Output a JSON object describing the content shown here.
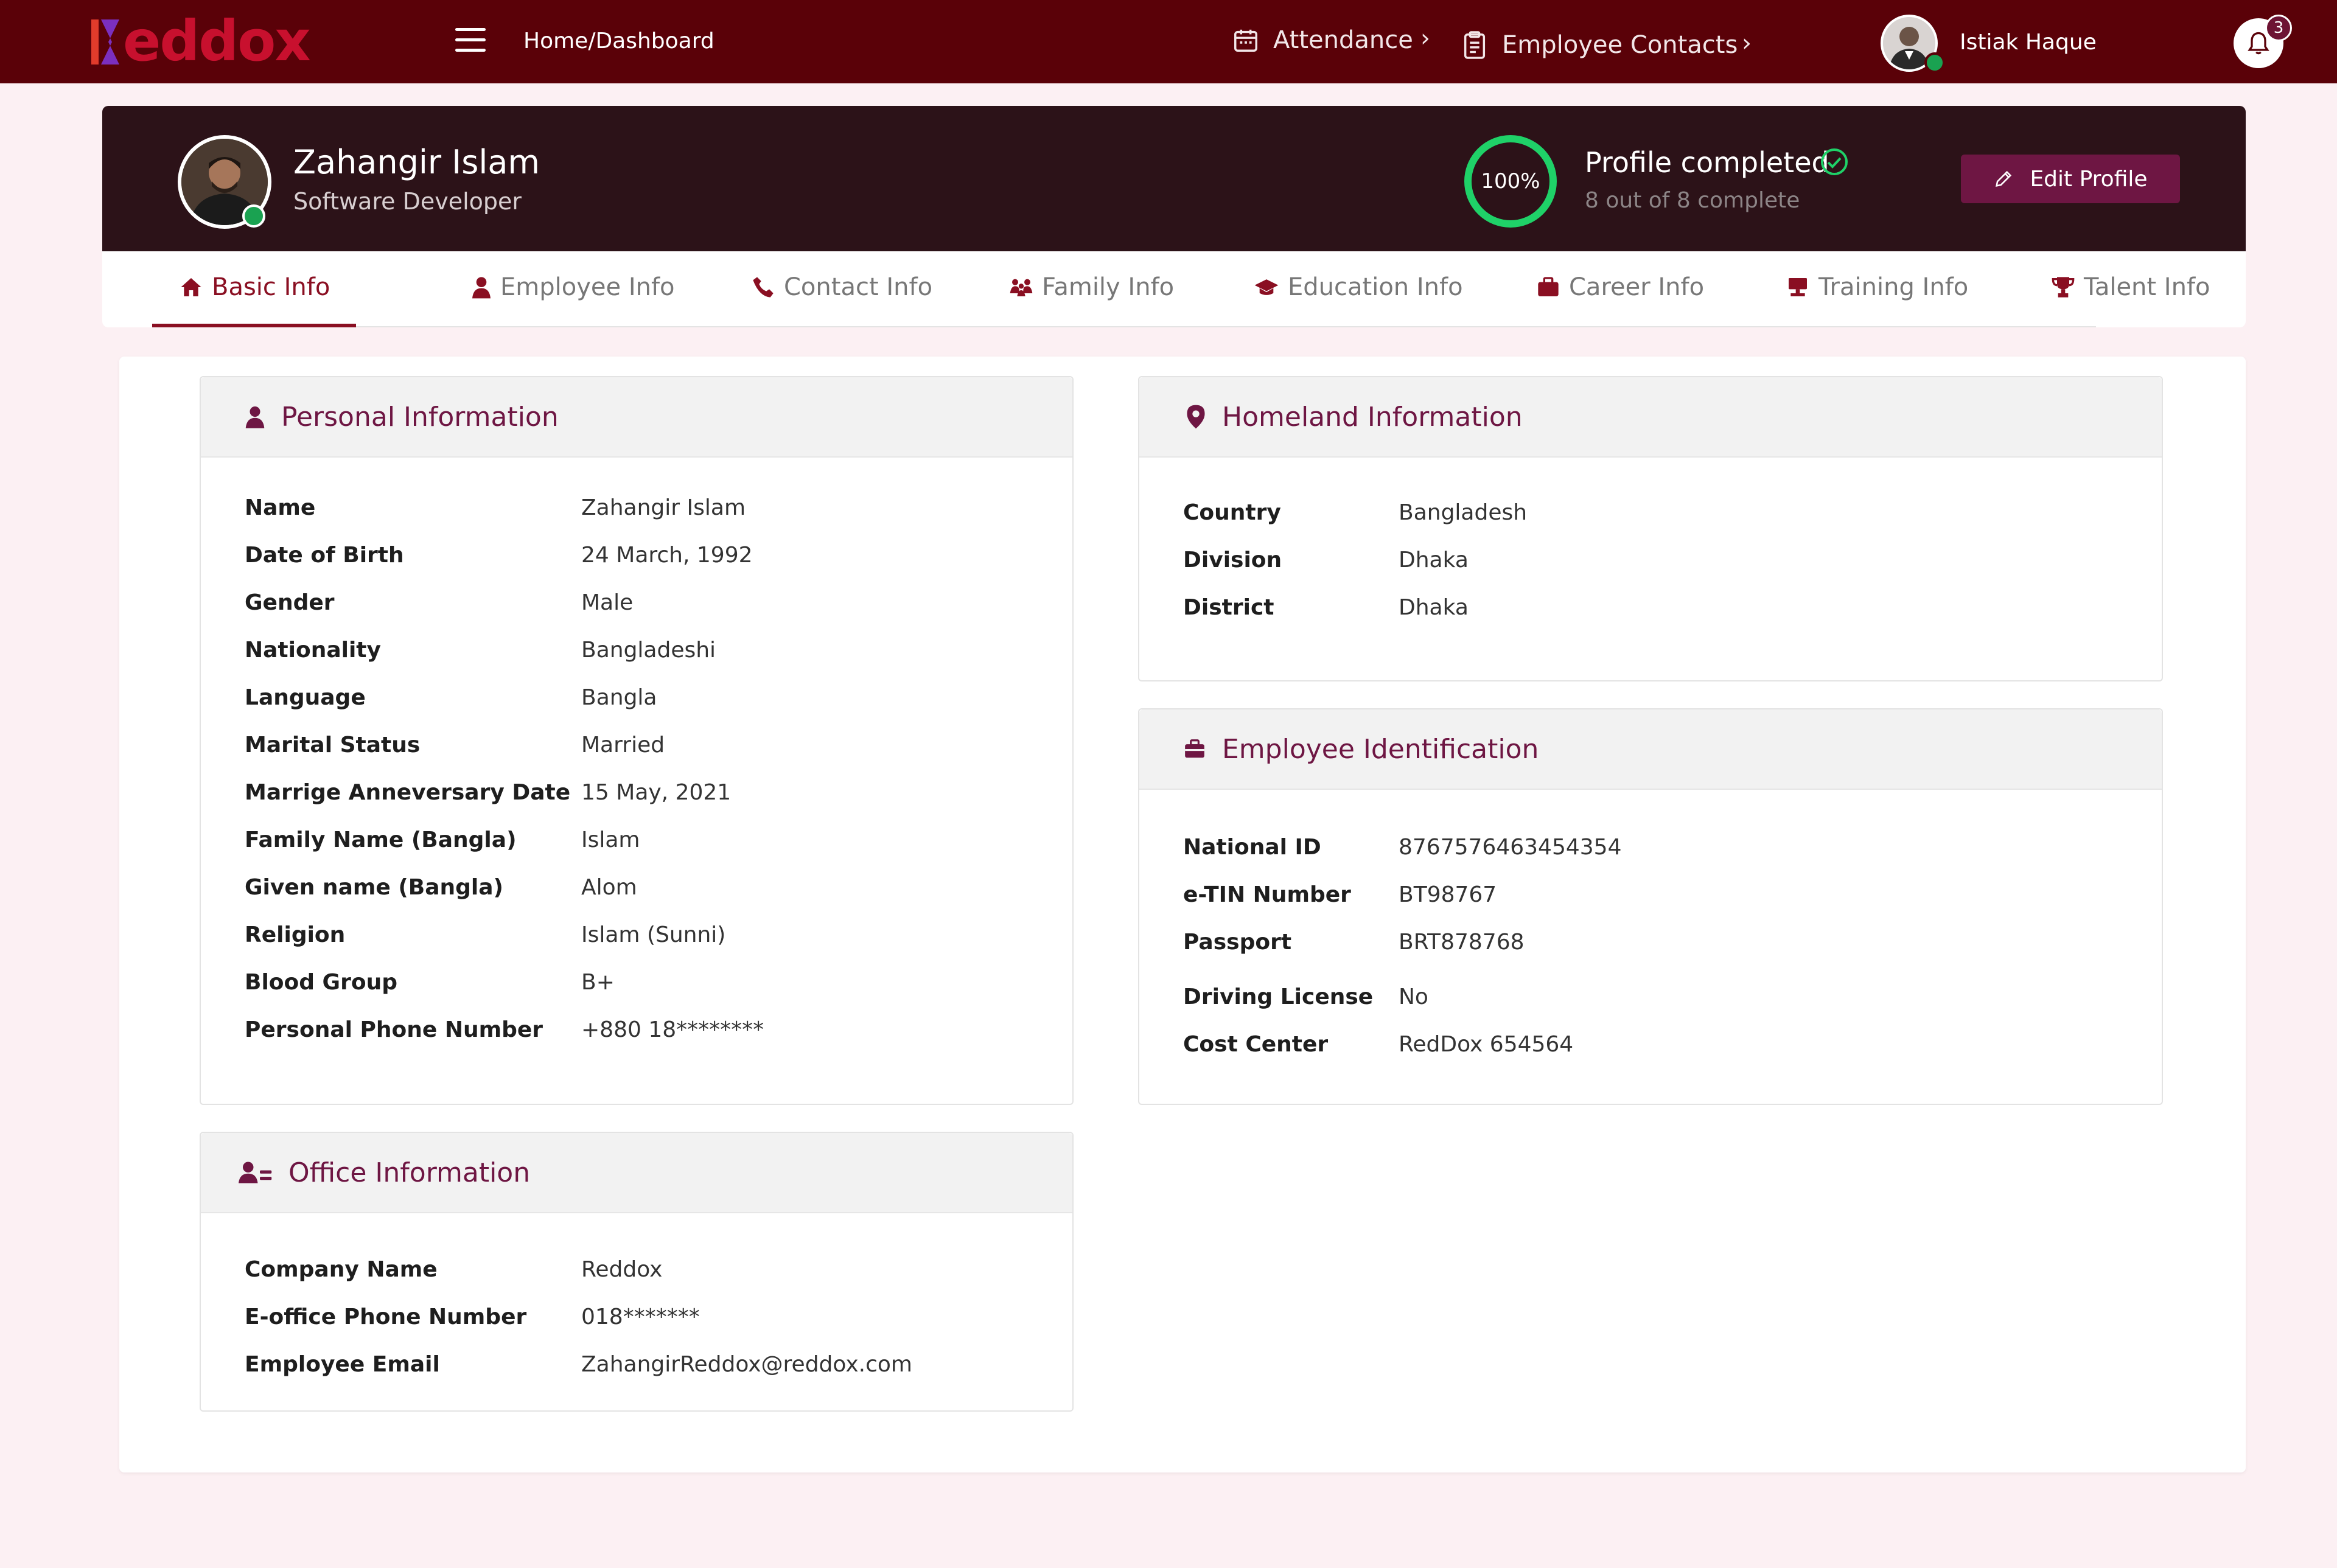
{
  "header": {
    "logo": "Reddox",
    "breadcrumb": "Home/Dashboard",
    "nav": [
      {
        "label": "Attendance",
        "icon": "calendar-icon"
      },
      {
        "label": "Employee Contacts",
        "icon": "clipboard-icon"
      }
    ],
    "user_name": "Istiak Haque",
    "notification_count": "3"
  },
  "profile": {
    "name": "Zahangir Islam",
    "role": "Software Developer",
    "completion_percent": "100%",
    "completion_title": "Profile completed",
    "completion_sub": "8 out of 8  complete",
    "edit_label": "Edit Profile"
  },
  "tabs": [
    {
      "label": "Basic Info",
      "icon": "home-icon",
      "active": true
    },
    {
      "label": "Employee Info",
      "icon": "person-icon"
    },
    {
      "label": "Contact Info",
      "icon": "phone-icon"
    },
    {
      "label": "Family Info",
      "icon": "family-icon"
    },
    {
      "label": "Education Info",
      "icon": "graduation-cap-icon"
    },
    {
      "label": "Career Info",
      "icon": "briefcase-icon"
    },
    {
      "label": "Training Info",
      "icon": "training-icon"
    },
    {
      "label": "Talent Info",
      "icon": "trophy-icon"
    }
  ],
  "personal": {
    "title": "Personal Information",
    "rows": [
      {
        "label": "Name",
        "value": "Zahangir Islam"
      },
      {
        "label": "Date of Birth",
        "value": "24 March, 1992"
      },
      {
        "label": "Gender",
        "value": "Male"
      },
      {
        "label": "Nationality",
        "value": "Bangladeshi"
      },
      {
        "label": "Language",
        "value": "Bangla"
      },
      {
        "label": "Marital Status",
        "value": "Married"
      },
      {
        "label": "Marrige Anneversary Date",
        "value": "15 May, 2021"
      },
      {
        "label": "Family Name (Bangla)",
        "value": "Islam"
      },
      {
        "label": "Given name (Bangla)",
        "value": "Alom"
      },
      {
        "label": "Religion",
        "value": "Islam (Sunni)"
      },
      {
        "label": "Blood Group",
        "value": "B+"
      },
      {
        "label": "Personal Phone Number",
        "value": "+880 18********"
      }
    ]
  },
  "office": {
    "title": "Office Information",
    "rows": [
      {
        "label": "Company Name",
        "value": "Reddox"
      },
      {
        "label": "E-office Phone Number",
        "value": "018*******"
      },
      {
        "label": "Employee Email",
        "value": "ZahangirReddox@reddox.com"
      }
    ]
  },
  "homeland": {
    "title": "Homeland Information",
    "rows": [
      {
        "label": "Country",
        "value": "Bangladesh"
      },
      {
        "label": "Division",
        "value": "Dhaka"
      },
      {
        "label": "District",
        "value": "Dhaka"
      }
    ]
  },
  "identification": {
    "title": "Employee Identification",
    "rows": [
      {
        "label": "National ID",
        "value": "8767576463454354"
      },
      {
        "label": "e-TIN Number",
        "value": "BT98767"
      },
      {
        "label": "Passport",
        "value": "BRT878768"
      },
      {
        "label": "Driving License",
        "value": "No"
      },
      {
        "label": "Cost Center",
        "value": "RedDox 654564"
      }
    ]
  },
  "colors": {
    "topbar": "#5a0108",
    "accent": "#6e1643",
    "active_tab": "#8a0f22",
    "ring": "#1fd168"
  }
}
